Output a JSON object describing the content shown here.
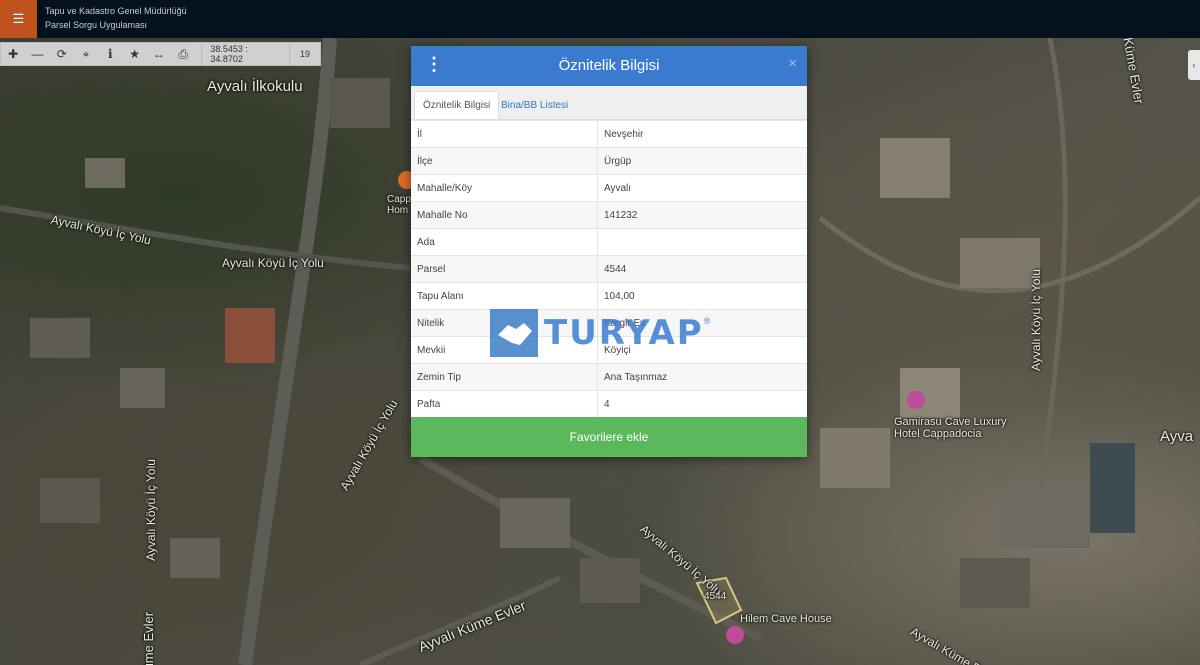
{
  "header": {
    "menu_icon": "hamburger-icon",
    "org_name": "Tapu ve Kadastro Genel Müdürlüğü",
    "app_name": "Parsel Sorgu Uygulaması"
  },
  "toolbar": {
    "coords": "38.5453 : 34.8702",
    "zoom": "19"
  },
  "map": {
    "labels": {
      "school": "Ayvalı İlkokulu",
      "road1": "Ayvalı Köyü İç Yolu",
      "road2": "Ayvalı Köyü İç Yolu",
      "road3": "Ayvalı Köyü İç Yolu",
      "road4": "Ayvalı Köyü İç Yolu",
      "road5": "Ayvalı Köyü İç Yolu",
      "road6": "Ayvalı Köyü İç Yolu",
      "kume1": "Ayvalı Küme Evler",
      "kume2": "Küme Evler",
      "kume3": "Küme Evler",
      "kume4": "Ayvalı Küme Evler",
      "hotel": "Gamirasu Cave Luxury\nHotel Cappadocia",
      "cave_house": "Hilem Cave House",
      "parcel": "4544",
      "capp": "Capp\nHom",
      "ayva": "Ayva"
    }
  },
  "dialog": {
    "title": "Öznitelik Bilgisi",
    "close": "×",
    "tabs": [
      "Öznitelik Bilgisi",
      "Bina/BB Listesi"
    ],
    "rows": [
      {
        "key": "İl",
        "value": "Nevşehir"
      },
      {
        "key": "İlçe",
        "value": "Ürgüp"
      },
      {
        "key": "Mahalle/Köy",
        "value": "Ayvalı"
      },
      {
        "key": "Mahalle No",
        "value": "141232"
      },
      {
        "key": "Ada",
        "value": ""
      },
      {
        "key": "Parsel",
        "value": "4544"
      },
      {
        "key": "Tapu Alanı",
        "value": "104,00"
      },
      {
        "key": "Nitelik",
        "value": "Kargir Ev"
      },
      {
        "key": "Mevkii",
        "value": "Köyiçi"
      },
      {
        "key": "Zemin Tip",
        "value": "Ana Taşınmaz"
      },
      {
        "key": "Pafta",
        "value": "4"
      }
    ],
    "fav_button": "Favorilere ekle"
  },
  "watermark": {
    "text": "TURYAP",
    "reg": "®"
  }
}
